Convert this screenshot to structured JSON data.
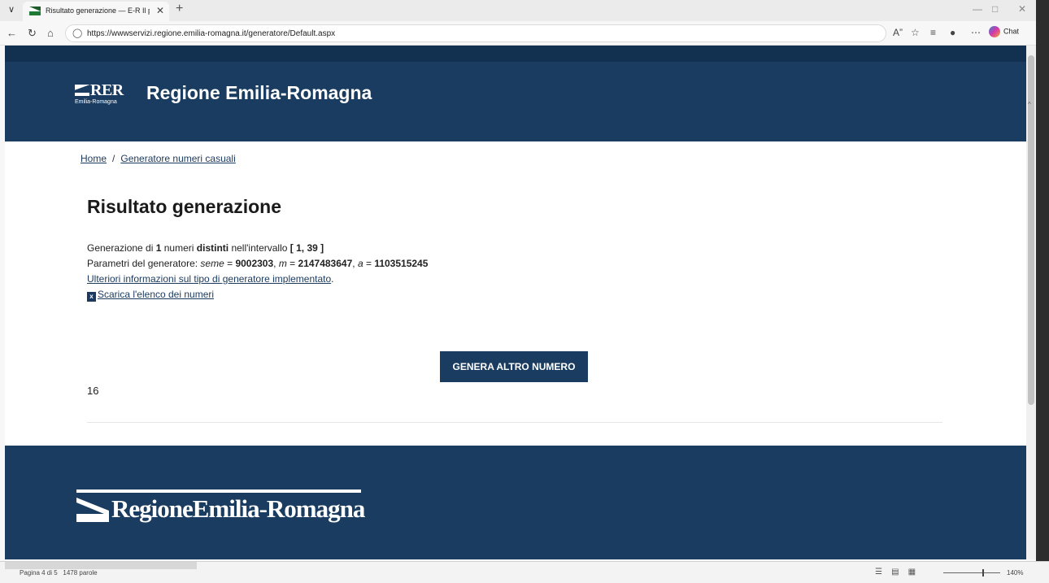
{
  "browser": {
    "tab_title": "Risultato generazione — E-R Il por",
    "url": "https://wwwservizi.regione.emilia-romagna.it/generatore/Default.aspx",
    "chat_label": "Chat",
    "icons": [
      "tabs-menu-icon",
      "favicon",
      "close-icon",
      "new-tab-icon",
      "back-icon",
      "refresh-icon",
      "home-icon",
      "lock-icon",
      "read-aloud-icon",
      "favorite-icon",
      "collections-icon",
      "profile-icon",
      "more-icon",
      "copilot-icon"
    ]
  },
  "header": {
    "logo_mark": "RER",
    "logo_sub": "Emilia-Romagna",
    "site_title": "Regione Emilia-Romagna"
  },
  "breadcrumb": {
    "home": "Home",
    "separator": "/",
    "current": "Generatore numeri casuali"
  },
  "main": {
    "page_title": "Risultato generazione",
    "line1": {
      "prefix": "Generazione di ",
      "count": "1",
      "mid": " numeri ",
      "distinct": "distinti",
      "mid2": " nell'intervallo ",
      "range": "[ 1, 39 ]"
    },
    "line2": {
      "prefix": "Parametri del generatore: ",
      "seed_label": "seme",
      "eq1": " = ",
      "seed": "9002303",
      "sep1": ", ",
      "m_label": "m",
      "eq2": " = ",
      "m": "2147483647",
      "sep2": ", ",
      "a_label": "a",
      "eq3": " = ",
      "a": "1103515245"
    },
    "info_link": "Ulteriori informazioni sul tipo di generatore implementato",
    "info_link_suffix": ".",
    "download_link": "Scarica l'elenco dei numeri",
    "generate_button": "GENERA ALTRO NUMERO",
    "result": "16"
  },
  "footer": {
    "logo_text": "RegioneEmilia-Romagna"
  },
  "statusbar": {
    "page": "Pagina 4 di 5",
    "words": "1478 parole",
    "zoom": "140%"
  },
  "colors": {
    "header_bg": "#193c60",
    "topband_bg": "#12304f",
    "link": "#1b3a5e"
  }
}
